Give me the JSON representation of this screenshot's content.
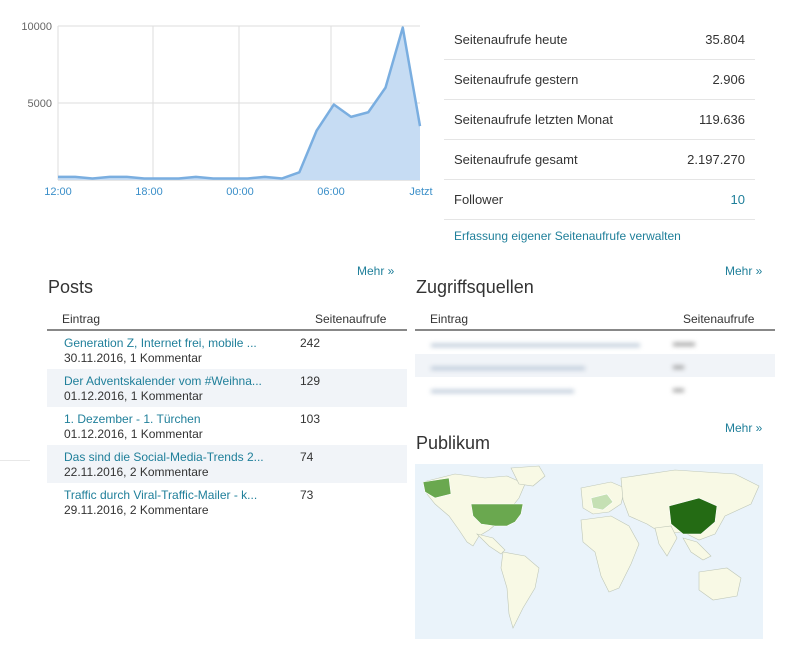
{
  "chart_data": {
    "type": "area",
    "title": "",
    "xlabel": "",
    "ylabel": "",
    "x_tick_labels": [
      "12:00",
      "18:00",
      "00:00",
      "06:00",
      "Jetzt"
    ],
    "y_tick_labels": [
      "10000",
      "5000"
    ],
    "ylim": [
      0,
      10000
    ],
    "grid": true,
    "series": [
      {
        "color": "#7aaee0",
        "values": [
          200,
          200,
          100,
          200,
          200,
          100,
          100,
          100,
          200,
          100,
          100,
          100,
          200,
          100,
          500,
          3200,
          4900,
          4100,
          4400,
          6000,
          9900,
          3500
        ]
      }
    ]
  },
  "stats": {
    "rows": [
      {
        "label": "Seitenaufrufe heute",
        "value": "35.804"
      },
      {
        "label": "Seitenaufrufe gestern",
        "value": "2.906"
      },
      {
        "label": "Seitenaufrufe letzten Monat",
        "value": "119.636"
      },
      {
        "label": "Seitenaufrufe gesamt",
        "value": "2.197.270"
      },
      {
        "label": "Follower",
        "value": "10"
      }
    ],
    "manage_link": "Erfassung eigener Seitenaufrufe verwalten"
  },
  "posts": {
    "title": "Posts",
    "more": "Mehr »",
    "col_entry": "Eintrag",
    "col_views": "Seitenaufrufe",
    "rows": [
      {
        "title": "Generation Z, Internet frei, mobile ...",
        "meta": "30.11.2016, 1 Kommentar",
        "views": "242"
      },
      {
        "title": "Der Adventskalender vom #Weihna...",
        "meta": "01.12.2016, 1 Kommentar",
        "views": "129"
      },
      {
        "title": "1. Dezember - 1. Türchen",
        "meta": "01.12.2016, 1 Kommentar",
        "views": "103"
      },
      {
        "title": "Das sind die Social-Media-Trends 2...",
        "meta": "22.11.2016, 2 Kommentare",
        "views": "74"
      },
      {
        "title": "Traffic durch Viral-Traffic-Mailer - k...",
        "meta": "29.11.2016, 2 Kommentare",
        "views": "73"
      }
    ]
  },
  "sources": {
    "title": "Zugriffsquellen",
    "more": "Mehr »",
    "col_entry": "Eintrag",
    "col_views": "Seitenaufrufe"
  },
  "audience": {
    "title": "Publikum",
    "more": "Mehr »",
    "colors": {
      "water": "#eaf3fa",
      "land": "#f8f9e5",
      "high": "#246b14",
      "mid": "#6aa84f",
      "low": "#c5e0b4"
    }
  }
}
